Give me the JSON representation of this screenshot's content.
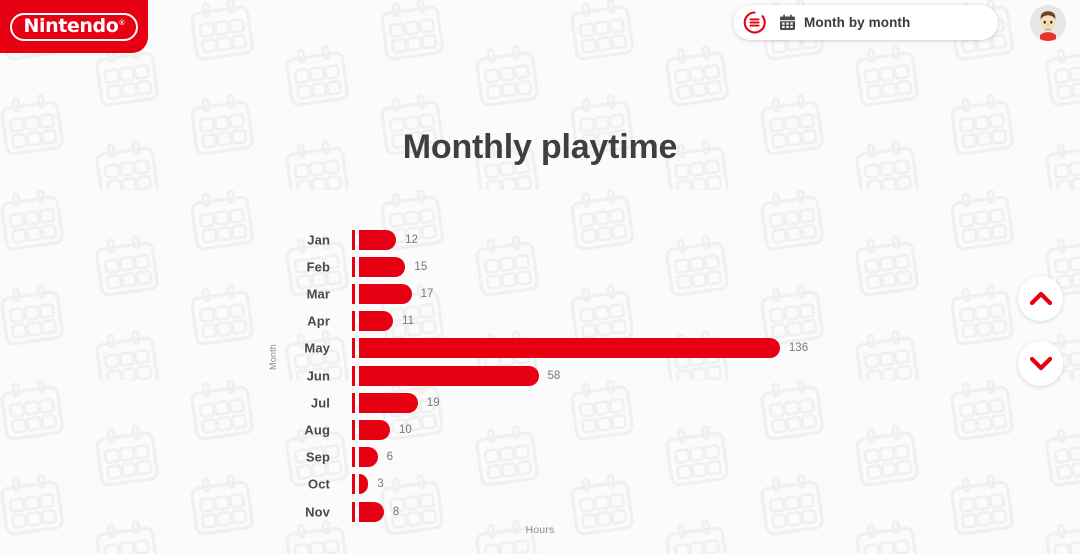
{
  "brand": {
    "logo_text": "Nintendo",
    "registered_mark": "®",
    "red": "#e60012"
  },
  "header": {
    "menu_icon": "hamburger-circle-icon",
    "calendar_icon": "calendar-icon",
    "filter_label": "Month by month",
    "avatar_icon": "mii-avatar"
  },
  "controls": {
    "scroll_up_icon": "chevron-up-icon",
    "scroll_down_icon": "chevron-down-icon"
  },
  "chart_data": {
    "type": "bar",
    "orientation": "horizontal",
    "title": "Monthly playtime",
    "xlabel": "Hours",
    "ylabel": "Month",
    "categories": [
      "Jan",
      "Feb",
      "Mar",
      "Apr",
      "May",
      "Jun",
      "Jul",
      "Aug",
      "Sep",
      "Oct",
      "Nov"
    ],
    "values": [
      12,
      15,
      17,
      11,
      136,
      58,
      19,
      10,
      6,
      3,
      8
    ],
    "xlim": [
      0,
      136
    ],
    "grid": false,
    "legend": false,
    "bar_color": "#e60012",
    "value_labels": [
      "12",
      "15",
      "17",
      "11",
      "136",
      "58",
      "19",
      "10",
      "6",
      "3",
      "8"
    ]
  }
}
